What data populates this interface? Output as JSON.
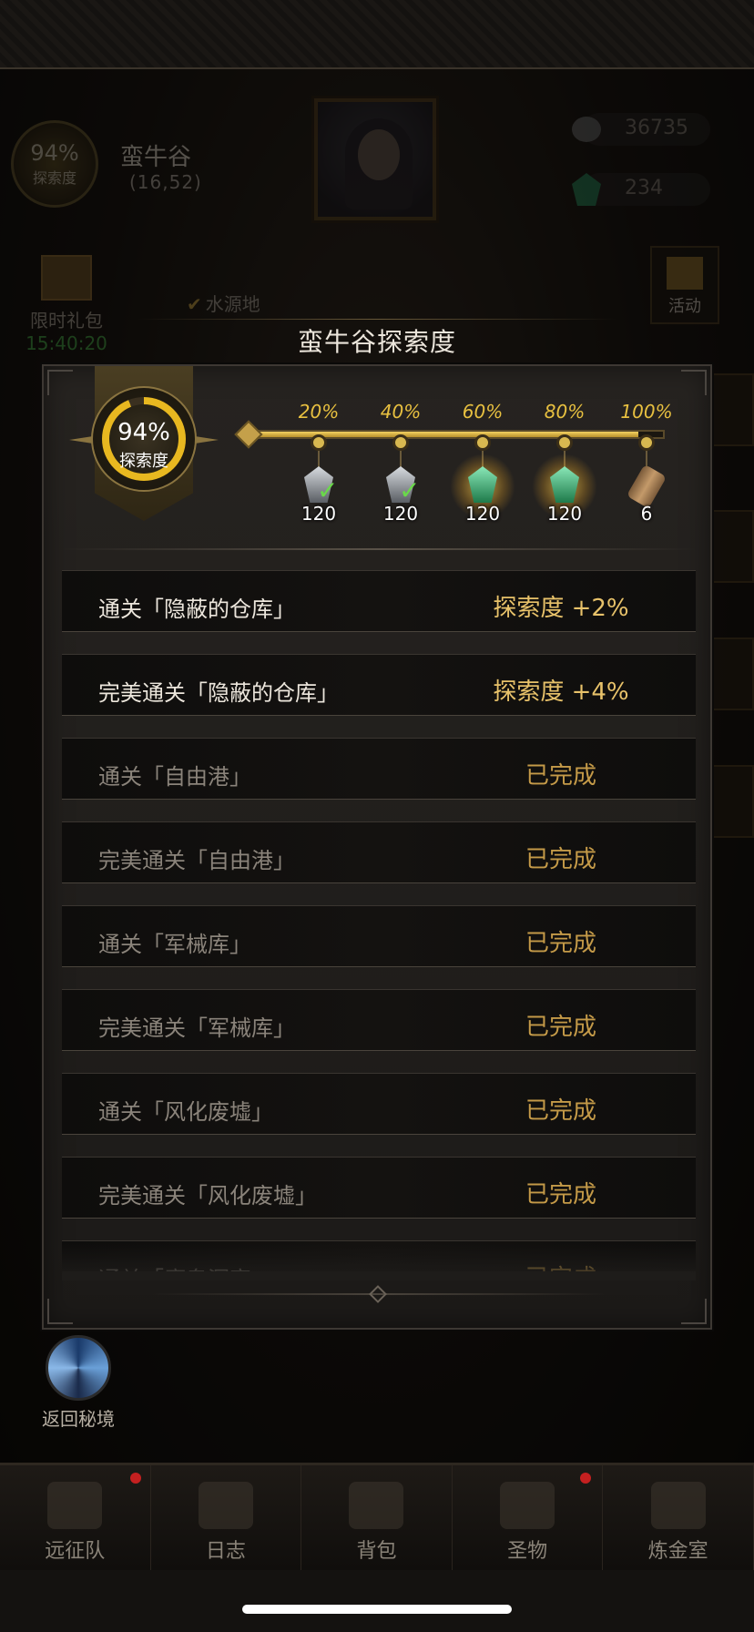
{
  "location": {
    "exploration_percent": "94%",
    "exploration_label": "探索度",
    "name": "蛮牛谷",
    "coords": "(16,52)"
  },
  "resources": {
    "stone": "36735",
    "gem": "234"
  },
  "gift": {
    "label": "限时礼包",
    "timer": "15:40:20"
  },
  "water_source": "水源地",
  "activity_label": "活动",
  "return_label": "返回秘境",
  "modal": {
    "title": "蛮牛谷探索度",
    "badge_percent": "94%",
    "badge_label": "探索度",
    "progress": 0.94,
    "milestones": [
      {
        "percent": "20%",
        "quantity": "120",
        "item": "grey-crystal",
        "claimed": true
      },
      {
        "percent": "40%",
        "quantity": "120",
        "item": "grey-crystal",
        "claimed": true
      },
      {
        "percent": "60%",
        "quantity": "120",
        "item": "green-crystal",
        "claimed": false
      },
      {
        "percent": "80%",
        "quantity": "120",
        "item": "green-crystal",
        "claimed": false
      },
      {
        "percent": "100%",
        "quantity": "6",
        "item": "scroll",
        "claimed": false
      }
    ],
    "tasks": [
      {
        "name": "通关「隐蔽的仓库」",
        "reward": "探索度 +2%",
        "status": "active"
      },
      {
        "name": "完美通关「隐蔽的仓库」",
        "reward": "探索度 +4%",
        "status": "active"
      },
      {
        "name": "通关「自由港」",
        "reward": "已完成",
        "status": "done"
      },
      {
        "name": "完美通关「自由港」",
        "reward": "已完成",
        "status": "done"
      },
      {
        "name": "通关「军械库」",
        "reward": "已完成",
        "status": "done"
      },
      {
        "name": "完美通关「军械库」",
        "reward": "已完成",
        "status": "done"
      },
      {
        "name": "通关「风化废墟」",
        "reward": "已完成",
        "status": "done"
      },
      {
        "name": "完美通关「风化废墟」",
        "reward": "已完成",
        "status": "done"
      },
      {
        "name": "通关「魔鬼洞窟」",
        "reward": "已完成",
        "status": "done"
      }
    ]
  },
  "nav": [
    {
      "label": "远征队",
      "badge": true
    },
    {
      "label": "日志",
      "badge": false
    },
    {
      "label": "背包",
      "badge": false
    },
    {
      "label": "圣物",
      "badge": true
    },
    {
      "label": "炼金室",
      "badge": false
    }
  ]
}
